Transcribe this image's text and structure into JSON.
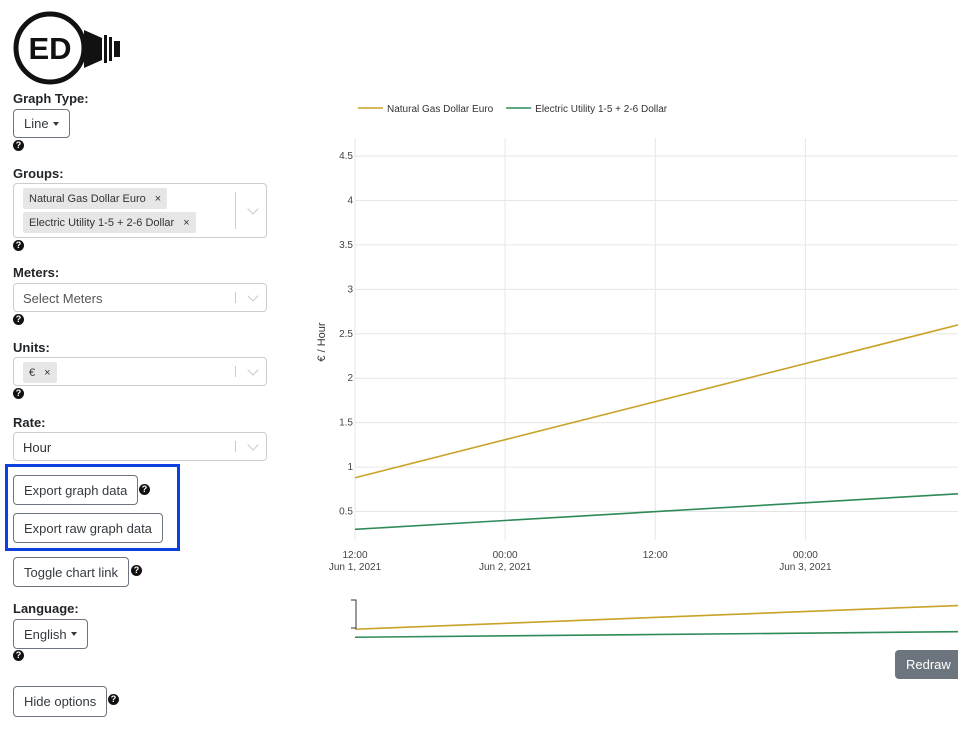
{
  "logo": {
    "text": "ED"
  },
  "sidebar": {
    "graph_type": {
      "label": "Graph Type:",
      "value": "Line"
    },
    "groups": {
      "label": "Groups:",
      "selected": [
        "Natural Gas Dollar Euro",
        "Electric Utility 1-5 + 2-6 Dollar"
      ]
    },
    "meters": {
      "label": "Meters:",
      "placeholder": "Select Meters"
    },
    "units": {
      "label": "Units:",
      "selected": "€"
    },
    "rate": {
      "label": "Rate:",
      "value": "Hour"
    },
    "export_graph": "Export graph data",
    "export_raw": "Export raw graph data",
    "toggle_chart_link": "Toggle chart link",
    "language": {
      "label": "Language:",
      "value": "English"
    },
    "hide_options": "Hide options",
    "help_glyph": "?",
    "remove_glyph": "×"
  },
  "redraw_label": "Redraw",
  "colors": {
    "gas": "#c9a227",
    "electric": "#2e8b57",
    "highlight": "#0b3fe0"
  },
  "chart_data": {
    "type": "line",
    "ylabel": "€ / Hour",
    "ylim": [
      0.18,
      4.68
    ],
    "yticks": [
      0.5,
      1,
      1.5,
      2,
      2.5,
      3,
      3.5,
      4,
      4.5
    ],
    "ytick_labels": [
      "0.5",
      "1",
      "1.5",
      "2",
      "2.5",
      "3",
      "3.5",
      "4",
      "4.5"
    ],
    "xlim": [
      12,
      60.2
    ],
    "xticks": [
      12,
      24,
      36,
      48
    ],
    "xtick_labels": [
      [
        "12:00",
        "Jun 1, 2021"
      ],
      [
        "00:00",
        "Jun 2, 2021"
      ],
      [
        "12:00",
        ""
      ],
      [
        "00:00",
        "Jun 3, 2021"
      ]
    ],
    "x_unit_note": "hours from 00:00 Jun 1, 2021",
    "legend": "top-left",
    "series": [
      {
        "name": "Natural Gas Dollar Euro",
        "x": [
          12,
          60.2
        ],
        "values": [
          0.88,
          2.6
        ]
      },
      {
        "name": "Electric Utility 1-5 + 2-6 Dollar",
        "x": [
          12,
          60.2
        ],
        "values": [
          0.3,
          0.7
        ]
      }
    ]
  }
}
